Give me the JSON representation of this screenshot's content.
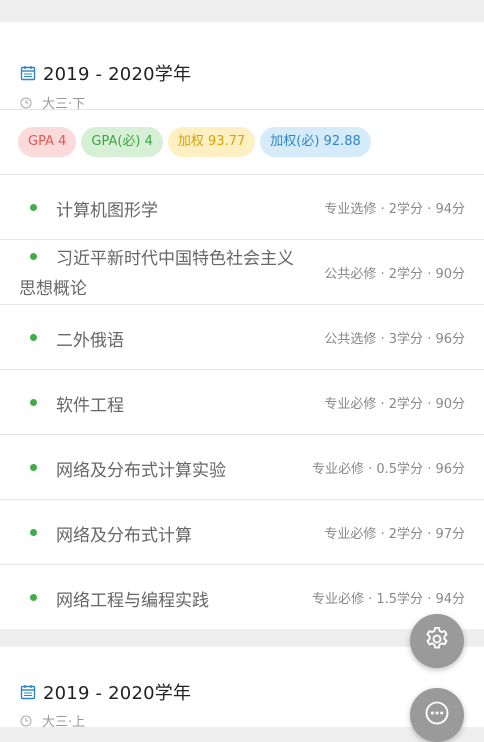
{
  "sections": [
    {
      "year": "2019 - 2020学年",
      "term": "大三·下",
      "badges": {
        "gpa": "GPA 4",
        "gpa_required": "GPA(必) 4",
        "weighted": "加权 93.77",
        "weighted_required": "加权(必) 92.88"
      },
      "courses": [
        {
          "name": "计算机图形学",
          "info": "专业选修 · 2学分 · 94分"
        },
        {
          "name": "习近平新时代中国特色社会主义思想概论",
          "info": "公共必修 · 2学分 · 90分"
        },
        {
          "name": "二外俄语",
          "info": "公共选修 · 3学分 · 96分"
        },
        {
          "name": "软件工程",
          "info": "专业必修 · 2学分 · 90分"
        },
        {
          "name": "网络及分布式计算实验",
          "info": "专业必修 · 0.5学分 · 96分"
        },
        {
          "name": "网络及分布式计算",
          "info": "专业必修 · 2学分 · 97分"
        },
        {
          "name": "网络工程与编程实践",
          "info": "专业必修 · 1.5学分 · 94分"
        }
      ]
    },
    {
      "year": "2019 - 2020学年",
      "term": "大三·上"
    }
  ],
  "fab": {
    "settings_icon": "gear-icon",
    "more_icon": "more-horizontal-icon"
  },
  "colors": {
    "accent_blue": "#2f86c7",
    "dot_green": "#3fae49",
    "fab_gray": "#9a9a9a"
  }
}
